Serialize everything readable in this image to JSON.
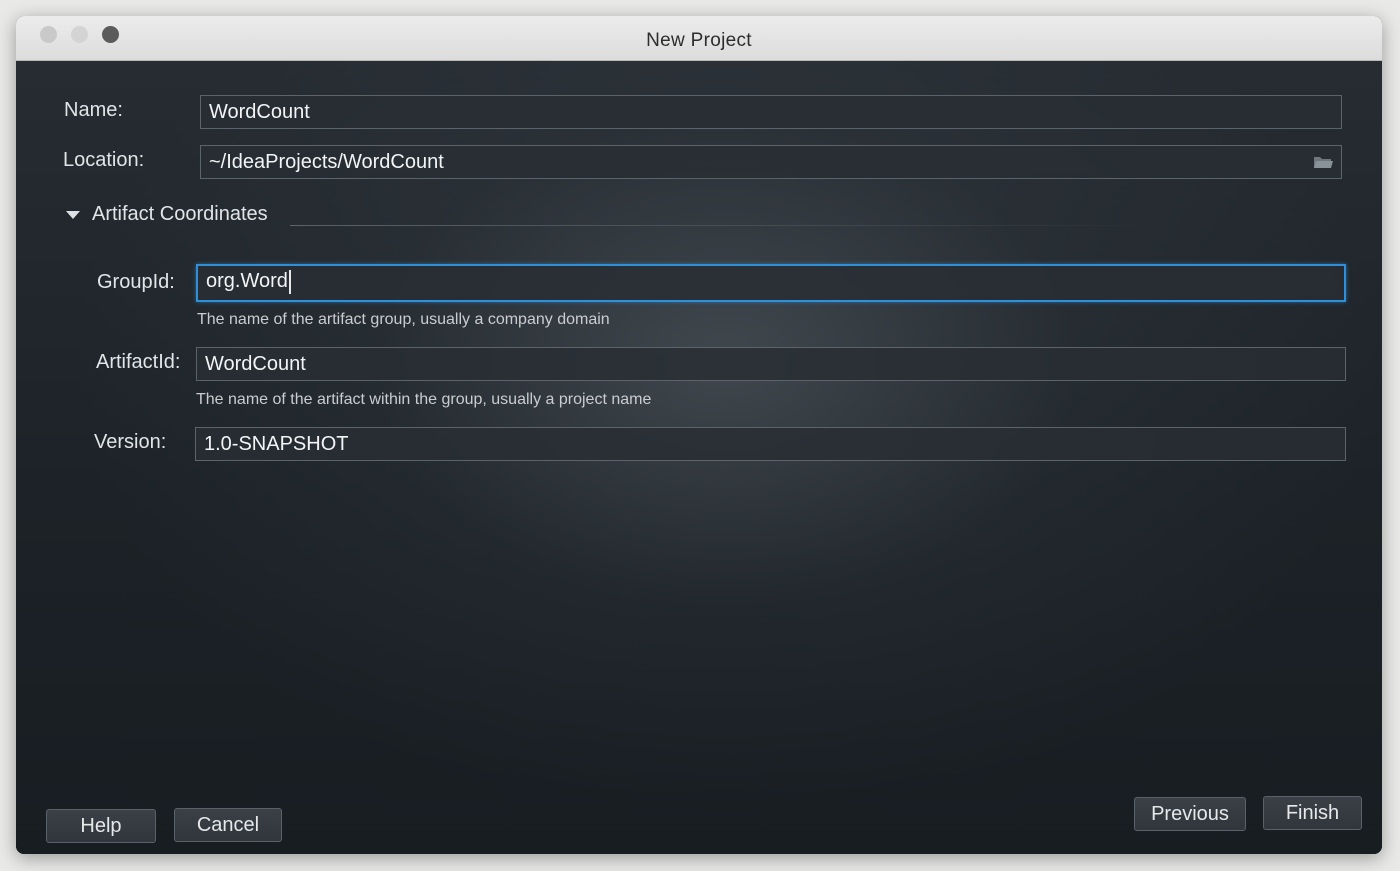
{
  "window": {
    "title": "New Project"
  },
  "form": {
    "name": {
      "label": "Name:",
      "value": "WordCount"
    },
    "location": {
      "label": "Location:",
      "value": "~/IdeaProjects/WordCount",
      "icon": "folder-icon"
    },
    "artifact_section": {
      "title": "Artifact Coordinates",
      "expanded": true
    },
    "group_id": {
      "label": "GroupId:",
      "value": "org.Word",
      "hint": "The name of the artifact group, usually a company domain",
      "focused": true
    },
    "artifact_id": {
      "label": "ArtifactId:",
      "value": "WordCount",
      "hint": "The name of the artifact within the group, usually a project name"
    },
    "version": {
      "label": "Version:",
      "value": "1.0-SNAPSHOT"
    }
  },
  "buttons": {
    "help": "Help",
    "cancel": "Cancel",
    "previous": "Previous",
    "finish": "Finish"
  },
  "colors": {
    "focus_accent": "#2f8fd8",
    "background": "#1b2026"
  }
}
